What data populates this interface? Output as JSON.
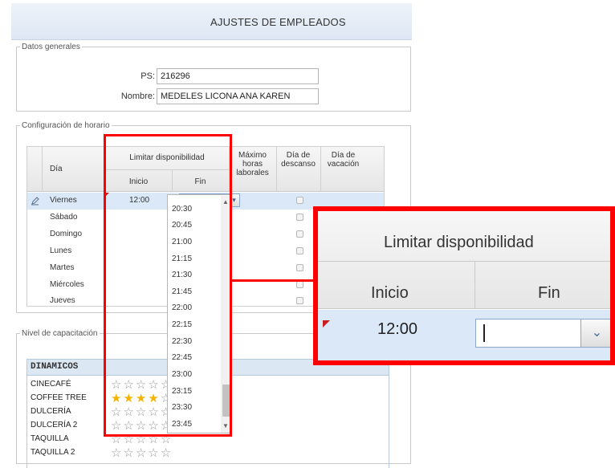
{
  "title": "AJUSTES DE EMPLEADOS",
  "general": {
    "legend": "Datos generales",
    "ps_label": "PS:",
    "ps_value": "216296",
    "name_label": "Nombre:",
    "name_value": "MEDELES LICONA ANA KAREN"
  },
  "schedule": {
    "legend": "Configuración de horario",
    "headers": {
      "day": "Día",
      "limit": "Limitar disponibilidad",
      "start": "Inicio",
      "end": "Fin",
      "max_hours": "Máximo horas laborales",
      "rest_day": "Día de descanso",
      "vacation_day": "Día de vacación"
    },
    "rows": [
      {
        "day": "Viernes",
        "start": "12:00"
      },
      {
        "day": "Sábado",
        "start": ""
      },
      {
        "day": "Domingo",
        "start": ""
      },
      {
        "day": "Lunes",
        "start": ""
      },
      {
        "day": "Martes",
        "start": ""
      },
      {
        "day": "Miércoles",
        "start": ""
      },
      {
        "day": "Jueves",
        "start": ""
      }
    ],
    "end_dropdown_options": [
      "20:30",
      "20:45",
      "21:00",
      "21:15",
      "21:30",
      "21:45",
      "22:00",
      "22:15",
      "22:30",
      "22:45",
      "23:00",
      "23:15",
      "23:30",
      "23:45"
    ]
  },
  "training": {
    "legend": "Nivel de capacitación",
    "group": "DINAMICOS",
    "items": [
      {
        "name": "CINECAFÉ",
        "stars": 0
      },
      {
        "name": "COFFEE TREE",
        "stars": 4
      },
      {
        "name": "DULCERÍA",
        "stars": 0
      },
      {
        "name": "DULCERÍA 2",
        "stars": 0
      },
      {
        "name": "TAQUILLA",
        "stars": 0
      },
      {
        "name": "TAQUILLA 2",
        "stars": 0
      }
    ]
  },
  "zoom": {
    "limit": "Limitar disponibilidad",
    "start": "Inicio",
    "end": "Fin",
    "start_value": "12:00"
  },
  "icons": {
    "edit": "pencil-icon",
    "dropdown": "chevron-down-icon",
    "star": "star-icon"
  },
  "colors": {
    "highlight": "#ff0000",
    "selected_row": "#dbe8f7",
    "star_on": "#f2b400"
  }
}
